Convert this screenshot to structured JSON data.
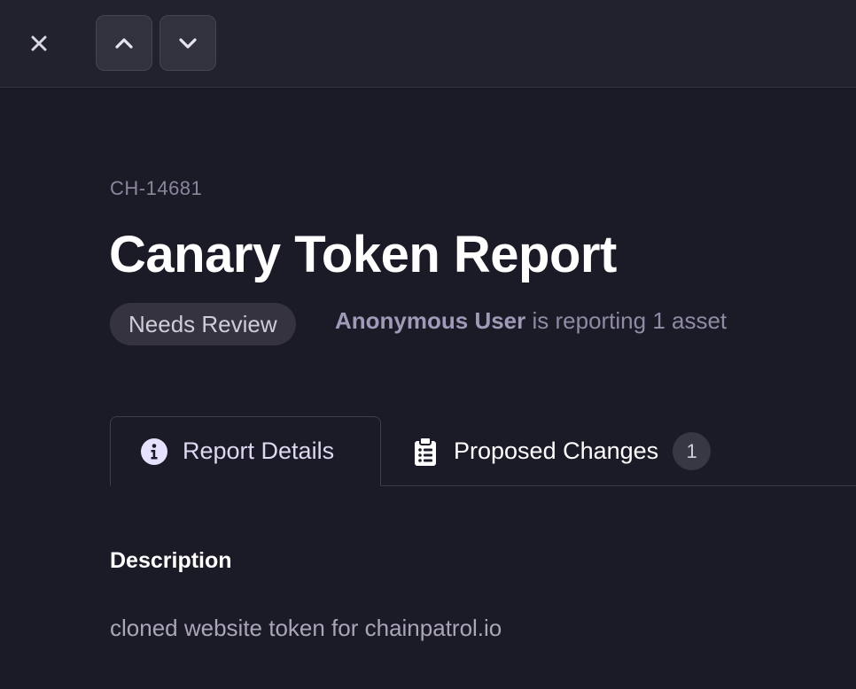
{
  "toolbar": {
    "close_icon": "close-icon",
    "prev_icon": "chevron-up-icon",
    "next_icon": "chevron-down-icon"
  },
  "report": {
    "id": "CH-14681",
    "title": "Canary Token Report",
    "status": "Needs Review",
    "reporter_name": "Anonymous User",
    "reporter_text": " is reporting 1 asset"
  },
  "tabs": [
    {
      "label": "Report Details",
      "icon": "info-circle-icon",
      "active": true
    },
    {
      "label": "Proposed Changes",
      "icon": "clipboard-list-icon",
      "count": "1"
    }
  ],
  "description": {
    "heading": "Description",
    "text": "cloned website token for chainpatrol.io"
  },
  "colors": {
    "background": "#1b1a27",
    "topbar": "#22212e",
    "accent": "#9e9ab8",
    "info_icon": "#e6e1ff"
  }
}
